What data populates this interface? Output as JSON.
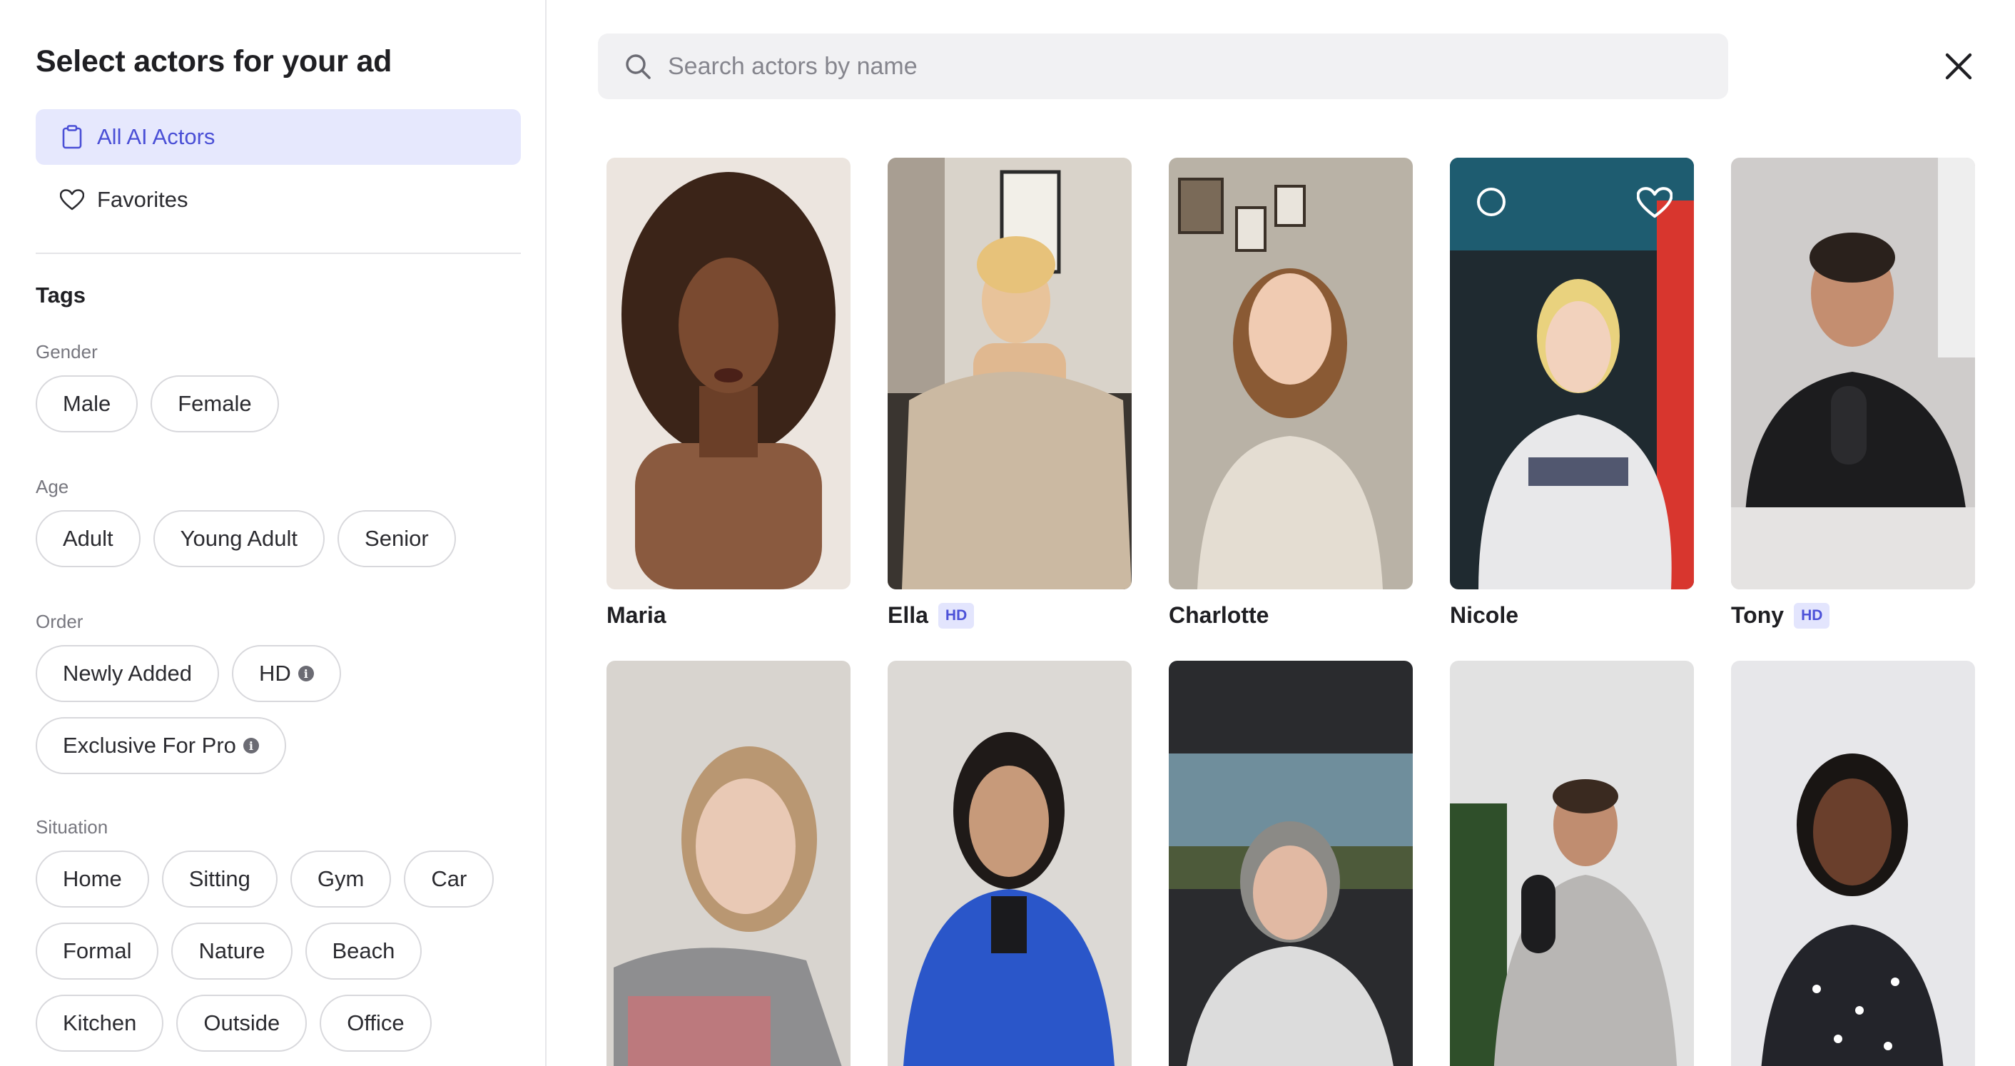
{
  "sidebar": {
    "title": "Select actors for your ad",
    "nav": [
      {
        "label": "All AI Actors",
        "icon": "clipboard-icon",
        "active": true
      },
      {
        "label": "Favorites",
        "icon": "heart-icon",
        "active": false
      }
    ],
    "tags_title": "Tags",
    "groups": {
      "gender": {
        "label": "Gender",
        "options": [
          "Male",
          "Female"
        ]
      },
      "age": {
        "label": "Age",
        "options": [
          "Adult",
          "Young Adult",
          "Senior"
        ]
      },
      "order": {
        "label": "Order",
        "options": [
          "Newly Added",
          "HD",
          "Exclusive For Pro"
        ]
      },
      "situation": {
        "label": "Situation",
        "options": [
          "Home",
          "Sitting",
          "Gym",
          "Car",
          "Formal",
          "Nature",
          "Beach",
          "Kitchen",
          "Outside",
          "Office"
        ]
      }
    }
  },
  "search": {
    "placeholder": "Search actors by name"
  },
  "actors": [
    {
      "name": "Maria",
      "hd": false
    },
    {
      "name": "Ella",
      "hd": true
    },
    {
      "name": "Charlotte",
      "hd": false
    },
    {
      "name": "Nicole",
      "hd": false
    },
    {
      "name": "Tony",
      "hd": true
    },
    {
      "name": "",
      "hd": false
    },
    {
      "name": "",
      "hd": false
    },
    {
      "name": "",
      "hd": false
    },
    {
      "name": "",
      "hd": false
    },
    {
      "name": "",
      "hd": false
    }
  ],
  "badges": {
    "hd": "HD"
  },
  "colors": {
    "accent": "#4a4fd6",
    "active_bg": "#e6e8fd"
  }
}
